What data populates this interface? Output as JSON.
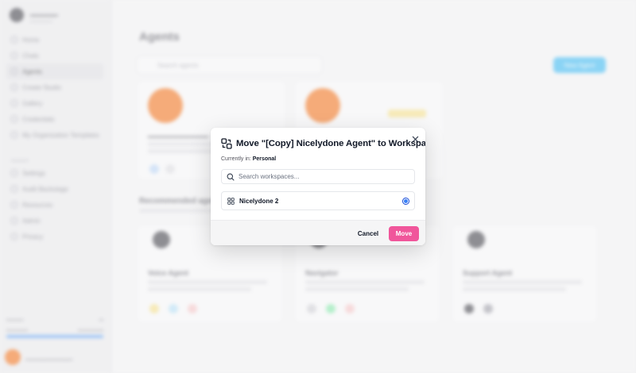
{
  "background": {
    "page_title": "Agents",
    "search_placeholder": "Search agents",
    "create_button": "New Agent",
    "nav_items": [
      "Home",
      "Chats",
      "Agents",
      "Create Studio",
      "Gallery",
      "Credentials",
      "My Organization Templates"
    ],
    "nav_items_2": [
      "Settings",
      "Audit Backstage",
      "Resources",
      "Admin",
      "Privacy"
    ],
    "section_title": "Recommended agents",
    "recommended_cards": [
      "Voice Agent",
      "Navigator",
      "Support Agent"
    ]
  },
  "modal": {
    "title": "Move \"[Copy] Nicelydone Agent\" to Workspace",
    "current_label": "Currently in:",
    "current_value": "Personal",
    "search_placeholder": "Search workspaces...",
    "options": [
      {
        "label": "Nicelydone 2",
        "selected": true
      }
    ],
    "cancel_label": "Cancel",
    "move_label": "Move"
  },
  "colors": {
    "accent_pink": "#f0569b",
    "radio_blue": "#3b82f6",
    "avatar_orange": "#f97316"
  },
  "icons": {
    "close": "close-icon",
    "move": "move-workspace-icon",
    "search": "search-icon",
    "workspace": "workspace-grid-icon"
  }
}
